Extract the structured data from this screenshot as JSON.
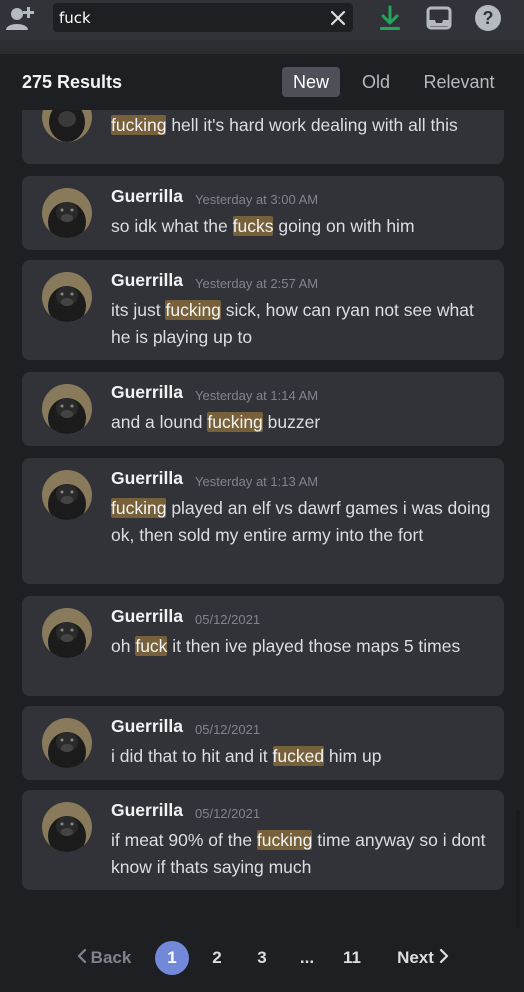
{
  "search": {
    "query": "fuck"
  },
  "icons": {
    "add_friend": "add-friend-icon",
    "clear": "close-icon",
    "download": "download-icon",
    "inbox": "inbox-icon",
    "help": "help-icon"
  },
  "colors": {
    "highlight": "#77613a",
    "download": "#23a55a",
    "active_page": "#7289da",
    "active_sort": "#4e5058"
  },
  "results": {
    "count": "275 Results",
    "sort_tabs": [
      {
        "label": "New",
        "active": true
      },
      {
        "label": "Old",
        "active": false
      },
      {
        "label": "Relevant",
        "active": false
      }
    ],
    "items": [
      {
        "author": "",
        "timestamp": "",
        "segments": [
          {
            "text": "fucking",
            "hl": true
          },
          {
            "text": " hell it's hard work dealing with all this",
            "hl": false
          }
        ]
      },
      {
        "author": "Guerrilla",
        "timestamp": "Yesterday at 3:00 AM",
        "segments": [
          {
            "text": "so idk what the ",
            "hl": false
          },
          {
            "text": "fucks",
            "hl": true
          },
          {
            "text": " going on with him",
            "hl": false
          }
        ]
      },
      {
        "author": "Guerrilla",
        "timestamp": "Yesterday at 2:57 AM",
        "segments": [
          {
            "text": "its just ",
            "hl": false
          },
          {
            "text": "fucking",
            "hl": true
          },
          {
            "text": " sick, how can ryan not see what he is playing up to",
            "hl": false
          }
        ]
      },
      {
        "author": "Guerrilla",
        "timestamp": "Yesterday at 1:14 AM",
        "segments": [
          {
            "text": "and a lound ",
            "hl": false
          },
          {
            "text": "fucking",
            "hl": true
          },
          {
            "text": " buzzer",
            "hl": false
          }
        ]
      },
      {
        "author": "Guerrilla",
        "timestamp": "Yesterday at 1:13 AM",
        "segments": [
          {
            "text": "fucking",
            "hl": true
          },
          {
            "text": " played an elf vs dawrf games i was doing ok, then sold my entire army into the fort",
            "hl": false
          }
        ]
      },
      {
        "author": "Guerrilla",
        "timestamp": "05/12/2021",
        "segments": [
          {
            "text": "oh ",
            "hl": false
          },
          {
            "text": "fuck",
            "hl": true
          },
          {
            "text": " it then ive played those maps 5 times",
            "hl": false
          }
        ]
      },
      {
        "author": "Guerrilla",
        "timestamp": "05/12/2021",
        "segments": [
          {
            "text": "i did that to hit and it ",
            "hl": false
          },
          {
            "text": "fucked",
            "hl": true
          },
          {
            "text": " him up",
            "hl": false
          }
        ]
      },
      {
        "author": "Guerrilla",
        "timestamp": "05/12/2021",
        "segments": [
          {
            "text": "if meat 90% of the ",
            "hl": false
          },
          {
            "text": "fucking",
            "hl": true
          },
          {
            "text": " time anyway so i dont know if thats saying much",
            "hl": false
          }
        ]
      }
    ]
  },
  "pagination": {
    "back": "Back",
    "next": "Next",
    "pages": [
      {
        "label": "1",
        "active": true
      },
      {
        "label": "2",
        "active": false
      },
      {
        "label": "3",
        "active": false
      },
      {
        "label": "...",
        "active": false
      },
      {
        "label": "11",
        "active": false
      }
    ]
  }
}
